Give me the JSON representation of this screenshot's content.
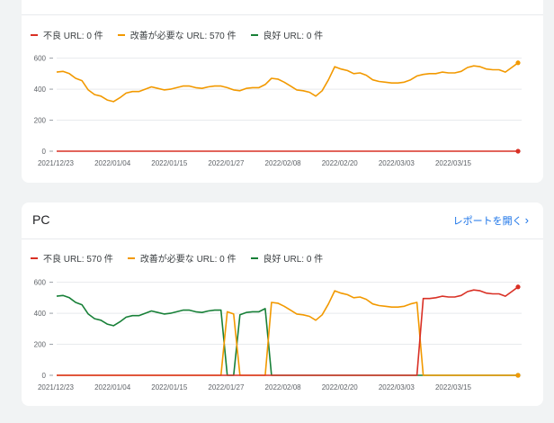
{
  "colors": {
    "bad": "#d93025",
    "needs": "#f29900",
    "good": "#188038",
    "link": "#1a73e8",
    "grid": "#e8eaed"
  },
  "mobile_section": {
    "legend": {
      "bad": "不良 URL: 0 件",
      "needs": "改善が必要な URL: 570 件",
      "good": "良好 URL: 0 件"
    }
  },
  "pc_section": {
    "title": "PC",
    "report_link": "レポートを開く",
    "report_icon": "chevron-right-icon",
    "legend": {
      "bad": "不良 URL: 570 件",
      "needs": "改善が必要な URL: 0 件",
      "good": "良好 URL: 0 件"
    }
  },
  "chart_data": [
    {
      "type": "line",
      "y_ticks": [
        0,
        200,
        400,
        600
      ],
      "ylim": [
        0,
        650
      ],
      "x_tick_labels": [
        "2021/12/23",
        "2022/01/04",
        "2022/01/15",
        "2022/01/27",
        "2022/02/08",
        "2022/02/20",
        "2022/03/03",
        "2022/03/15"
      ],
      "series": [
        {
          "name": "改善が必要な URL",
          "color": "#f29900",
          "values": [
            510,
            515,
            500,
            470,
            455,
            395,
            365,
            355,
            330,
            320,
            345,
            375,
            385,
            385,
            400,
            415,
            405,
            395,
            400,
            410,
            420,
            420,
            410,
            405,
            415,
            420,
            420,
            410,
            395,
            390,
            405,
            410,
            410,
            430,
            470,
            465,
            445,
            420,
            395,
            390,
            380,
            355,
            390,
            460,
            545,
            530,
            520,
            500,
            505,
            490,
            460,
            450,
            445,
            440,
            440,
            445,
            460,
            485,
            495,
            500,
            500,
            510,
            505,
            505,
            515,
            540,
            550,
            545,
            530,
            525,
            525,
            510,
            540,
            570
          ]
        },
        {
          "name": "不良 URL",
          "color": "#d93025",
          "values": [
            0,
            0,
            0,
            0,
            0,
            0,
            0,
            0,
            0,
            0,
            0,
            0,
            0,
            0,
            0,
            0,
            0,
            0,
            0,
            0,
            0,
            0,
            0,
            0,
            0,
            0,
            0,
            0,
            0,
            0,
            0,
            0,
            0,
            0,
            0,
            0,
            0,
            0,
            0,
            0,
            0,
            0,
            0,
            0,
            0,
            0,
            0,
            0,
            0,
            0,
            0,
            0,
            0,
            0,
            0,
            0,
            0,
            0,
            0,
            0,
            0,
            0,
            0,
            0,
            0,
            0,
            0,
            0,
            0,
            0,
            0,
            0,
            0,
            0
          ]
        }
      ]
    },
    {
      "type": "line",
      "y_ticks": [
        0,
        200,
        400,
        600
      ],
      "ylim": [
        0,
        650
      ],
      "x_tick_labels": [
        "2021/12/23",
        "2022/01/04",
        "2022/01/15",
        "2022/01/27",
        "2022/02/08",
        "2022/02/20",
        "2022/03/03",
        "2022/03/15"
      ],
      "series": [
        {
          "name": "良好 URL",
          "color": "#188038",
          "values": [
            510,
            515,
            500,
            470,
            455,
            395,
            365,
            355,
            330,
            320,
            345,
            375,
            385,
            385,
            400,
            415,
            405,
            395,
            400,
            410,
            420,
            420,
            410,
            405,
            415,
            420,
            420,
            0,
            0,
            390,
            405,
            410,
            410,
            430,
            0,
            0,
            0,
            0,
            0,
            0,
            0,
            0,
            0,
            0,
            0,
            0,
            0,
            0,
            0,
            0,
            0,
            0,
            0,
            0,
            0,
            0,
            0,
            0,
            0,
            0,
            0,
            0,
            0,
            0,
            0,
            0,
            0,
            0,
            0,
            0,
            0,
            0,
            0,
            0
          ]
        },
        {
          "name": "改善が必要な URL",
          "color": "#f29900",
          "values": [
            0,
            0,
            0,
            0,
            0,
            0,
            0,
            0,
            0,
            0,
            0,
            0,
            0,
            0,
            0,
            0,
            0,
            0,
            0,
            0,
            0,
            0,
            0,
            0,
            0,
            0,
            0,
            410,
            395,
            0,
            0,
            0,
            0,
            0,
            470,
            465,
            445,
            420,
            395,
            390,
            380,
            355,
            390,
            460,
            545,
            530,
            520,
            500,
            505,
            490,
            460,
            450,
            445,
            440,
            440,
            445,
            460,
            470,
            0,
            0,
            0,
            0,
            0,
            0,
            0,
            0,
            0,
            0,
            0,
            0,
            0,
            0,
            0,
            0
          ]
        },
        {
          "name": "不良 URL",
          "color": "#d93025",
          "values": [
            0,
            0,
            0,
            0,
            0,
            0,
            0,
            0,
            0,
            0,
            0,
            0,
            0,
            0,
            0,
            0,
            0,
            0,
            0,
            0,
            0,
            0,
            0,
            0,
            0,
            0,
            0,
            0,
            0,
            0,
            0,
            0,
            0,
            0,
            0,
            0,
            0,
            0,
            0,
            0,
            0,
            0,
            0,
            0,
            0,
            0,
            0,
            0,
            0,
            0,
            0,
            0,
            0,
            0,
            0,
            0,
            0,
            0,
            495,
            495,
            500,
            510,
            505,
            505,
            515,
            540,
            550,
            545,
            530,
            525,
            525,
            510,
            540,
            570
          ]
        }
      ]
    }
  ]
}
